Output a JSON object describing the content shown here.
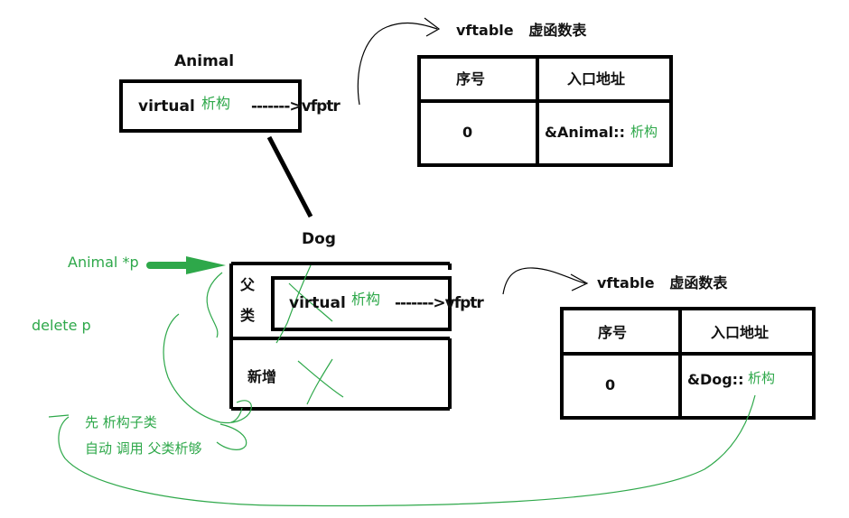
{
  "colors": {
    "ink": "#000000",
    "green": "#2ea84a"
  },
  "animal": {
    "title": "Animal",
    "virtual_label": "virtual",
    "dtor_label": "析构",
    "arrow_text": "------->vfptr"
  },
  "animal_vftable": {
    "title": "vftable   虚函数表",
    "col_index": "序号",
    "col_entry": "入口地址",
    "row_index": "0",
    "row_entry": "&Animal::",
    "row_entry_green": "析构"
  },
  "dog": {
    "title": "Dog",
    "parent_label_1": "父",
    "parent_label_2": "类",
    "virtual_label": "virtual",
    "dtor_label": "析构",
    "arrow_text": "------->vfptr",
    "new_label": "新增"
  },
  "dog_vftable": {
    "title": "vftable   虚函数表",
    "col_index": "序号",
    "col_entry": "入口地址",
    "row_index": "0",
    "row_entry": "&Dog::",
    "row_entry_green": "析构"
  },
  "notes": {
    "pointer": "Animal *p",
    "delete": "delete p",
    "first": "先 析构子类",
    "auto": "自动 调用 父类析够"
  }
}
